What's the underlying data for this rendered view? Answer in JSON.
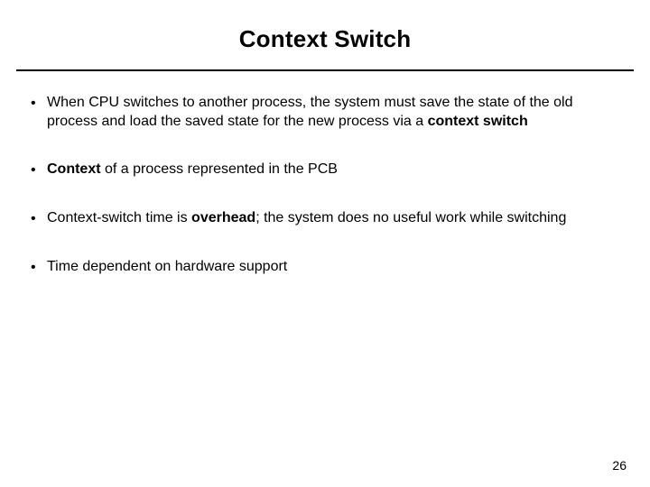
{
  "title": "Context Switch",
  "bullets": {
    "b1a": "When CPU switches to another process, the system must save the state of the old process and load the saved state for the new process via a ",
    "b1b": "context switch",
    "b2a": "Context",
    "b2b": " of a process represented in the PCB",
    "b3a": "Context-switch time is ",
    "b3b": "overhead",
    "b3c": "; the system does no useful work while switching",
    "b4": "Time dependent on hardware support"
  },
  "page_number": "26"
}
